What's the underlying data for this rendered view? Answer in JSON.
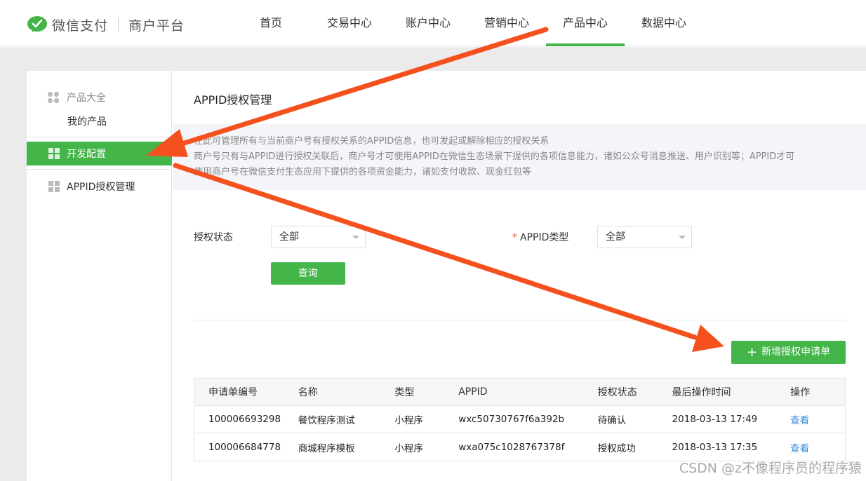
{
  "header": {
    "logo_text": "微信支付",
    "platform": "商户平台",
    "nav": [
      {
        "label": "首页"
      },
      {
        "label": "交易中心"
      },
      {
        "label": "账户中心"
      },
      {
        "label": "营销中心"
      },
      {
        "label": "产品中心",
        "active": true
      },
      {
        "label": "数据中心"
      }
    ]
  },
  "sidebar": {
    "group_label": "产品大全",
    "sub_label": "我的产品",
    "items": [
      {
        "label": "开发配置",
        "active": true
      },
      {
        "label": "APPID授权管理"
      }
    ]
  },
  "main": {
    "title": "APPID授权管理",
    "notice": [
      "在此可管理所有与当前商户号有授权关系的APPID信息，也可发起或解除相应的授权关系",
      "商户号只有与APPID进行授权关联后，商户号才可使用APPID在微信生态场景下提供的各项信息能力，诸如公众号消息推送、用户识别等；APPID才可",
      "使用商户号在微信支付生态应用下提供的各项资金能力，诸如支付收款、现金红包等"
    ],
    "filter": {
      "status_label": "授权状态",
      "status_value": "全部",
      "type_required": "*",
      "type_label": "APPID类型",
      "type_value": "全部",
      "query_label": "查询"
    },
    "add_button": "新增授权申请单",
    "add_icon": "+",
    "table": {
      "headers": [
        "申请单编号",
        "名称",
        "类型",
        "APPID",
        "授权状态",
        "最后操作时间",
        "操作"
      ],
      "rows": [
        [
          "100006693298",
          "餐饮程序测试",
          "小程序",
          "wxc50730767f6a392b",
          "待确认",
          "2018-03-13 17:49",
          "查看"
        ],
        [
          "100006684778",
          "商城程序模板",
          "小程序",
          "wxa075c1028767378f",
          "授权成功",
          "2018-03-13 17:35",
          "查看"
        ]
      ]
    }
  },
  "watermark": "CSDN @z不像程序员的程序猿",
  "colors": {
    "accent": "#44b549",
    "link": "#3b8fdb",
    "annotation_arrow": "#f4511e"
  }
}
